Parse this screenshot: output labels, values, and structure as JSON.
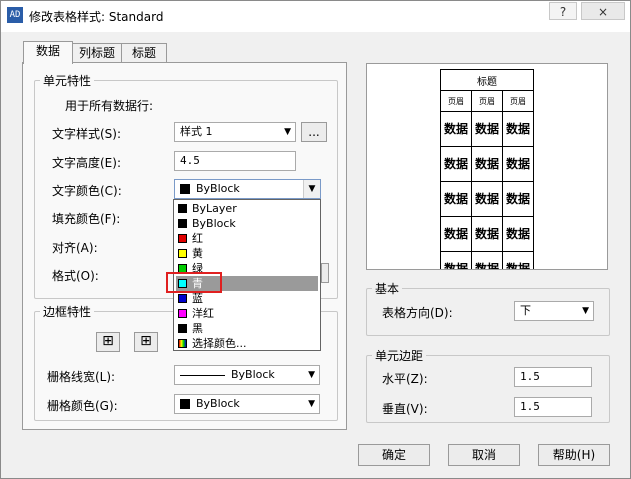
{
  "window": {
    "title": "修改表格样式: Standard",
    "app_icon": "AD",
    "help_symbol": "?",
    "close_symbol": "×"
  },
  "tabs": [
    {
      "label": "数据"
    },
    {
      "label": "列标题"
    },
    {
      "label": "标题"
    }
  ],
  "cell_props": {
    "legend": "单元特性",
    "apply_all": "用于所有数据行:",
    "text_style_label": "文字样式(S):",
    "text_style_value": "样式 1",
    "browse_label": "...",
    "text_height_label": "文字高度(E):",
    "text_height_value": "4.5",
    "text_color_label": "文字颜色(C):",
    "text_color_value": "ByBlock",
    "fill_color_label": "填充颜色(F):",
    "align_label": "对齐(A):",
    "format_label": "格式(O):"
  },
  "color_dropdown": {
    "items": [
      {
        "label": "ByLayer",
        "color": "#000000"
      },
      {
        "label": "ByBlock",
        "color": "#000000"
      },
      {
        "label": "红",
        "color": "#e00000"
      },
      {
        "label": "黄",
        "color": "#ffff00"
      },
      {
        "label": "绿",
        "color": "#00cc00"
      },
      {
        "label": "青",
        "color": "#00ffff"
      },
      {
        "label": "蓝",
        "color": "#0000cc"
      },
      {
        "label": "洋红",
        "color": "#ff00ff"
      },
      {
        "label": "黑",
        "color": "#000000"
      },
      {
        "label": "选择颜色...",
        "color": "multicolor"
      }
    ],
    "highlighted": "青"
  },
  "border_props": {
    "legend": "边框特性",
    "line_weight_label": "栅格线宽(L):",
    "line_weight_value": "ByBlock",
    "line_color_label": "栅格颜色(G):",
    "line_color_value": "ByBlock"
  },
  "preview": {
    "title": "标题",
    "header": "页眉",
    "data": "数据"
  },
  "basic": {
    "legend": "基本",
    "direction_label": "表格方向(D):",
    "direction_value": "下"
  },
  "margins": {
    "legend": "单元边距",
    "horizontal_label": "水平(Z):",
    "horizontal_value": "1.5",
    "vertical_label": "垂直(V):",
    "vertical_value": "1.5"
  },
  "buttons": {
    "ok": "确定",
    "cancel": "取消",
    "help": "帮助(H)"
  }
}
